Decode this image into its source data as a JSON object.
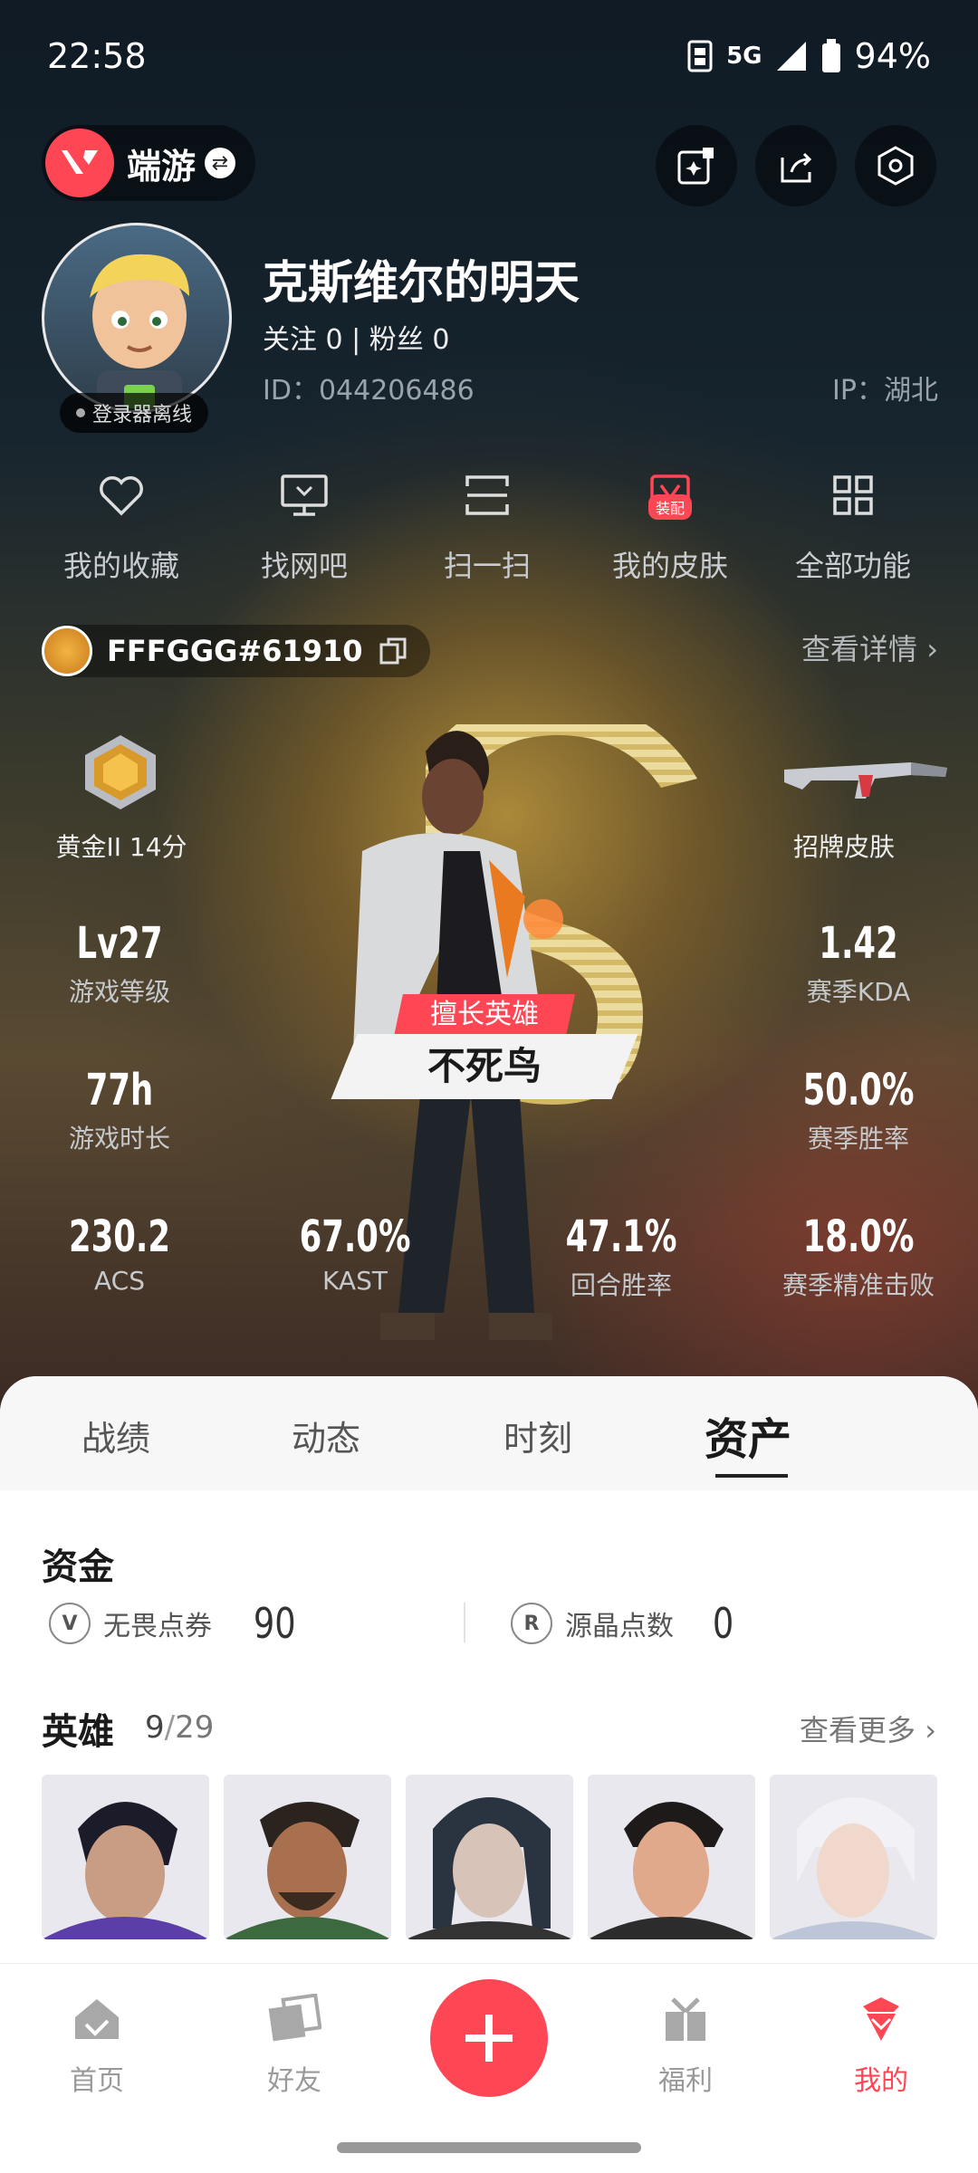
{
  "status_bar": {
    "time": "22:58",
    "network": "5G",
    "battery": "94%"
  },
  "top_bar": {
    "mode": "端游"
  },
  "profile": {
    "name": "克斯维尔的明天",
    "follow_text": "关注 0 | 粉丝 0",
    "id_text": "ID：044206486",
    "ip_text": "IP：湖北",
    "online_status": "登录器离线"
  },
  "quick_actions": [
    {
      "label": "我的收藏",
      "icon": "heart-icon"
    },
    {
      "label": "找网吧",
      "icon": "monitor-icon"
    },
    {
      "label": "扫一扫",
      "icon": "scan-icon"
    },
    {
      "label": "我的皮肤",
      "icon": "skin-icon",
      "badge": "装配"
    },
    {
      "label": "全部功能",
      "icon": "grid-icon"
    }
  ],
  "riot": {
    "id": "FFFGGG#61910",
    "detail_link": "查看详情"
  },
  "stats": {
    "rank": "黄金II 14分",
    "skin": "招牌皮肤",
    "level": {
      "value": "Lv27",
      "label": "游戏等级"
    },
    "kda": {
      "value": "1.42",
      "label": "赛季KDA"
    },
    "playtime": {
      "value": "77h",
      "label": "游戏时长"
    },
    "winrate": {
      "value": "50.0%",
      "label": "赛季胜率"
    },
    "acs": {
      "value": "230.2",
      "label": "ACS"
    },
    "kast": {
      "value": "67.0%",
      "label": "KAST"
    },
    "round_win": {
      "value": "47.1%",
      "label": "回合胜率"
    },
    "headshot": {
      "value": "18.0%",
      "label": "赛季精准击败"
    }
  },
  "agent": {
    "tag": "擅长英雄",
    "name": "不死鸟"
  },
  "tabs": [
    "战绩",
    "动态",
    "时刻",
    "资产"
  ],
  "assets": {
    "funds_title": "资金",
    "vp_label": "无畏点券",
    "vp_value": "90",
    "rp_label": "源晶点数",
    "rp_value": "0",
    "heroes_title": "英雄",
    "heroes_owned": "9",
    "heroes_total": "29",
    "more_link": "查看更多"
  },
  "bottom_nav": [
    {
      "label": "首页",
      "icon": "home-icon"
    },
    {
      "label": "好友",
      "icon": "friends-icon"
    },
    {
      "label": "福利",
      "icon": "gift-icon"
    },
    {
      "label": "我的",
      "icon": "profile-icon"
    }
  ],
  "colors": {
    "accent": "#ff4655"
  }
}
